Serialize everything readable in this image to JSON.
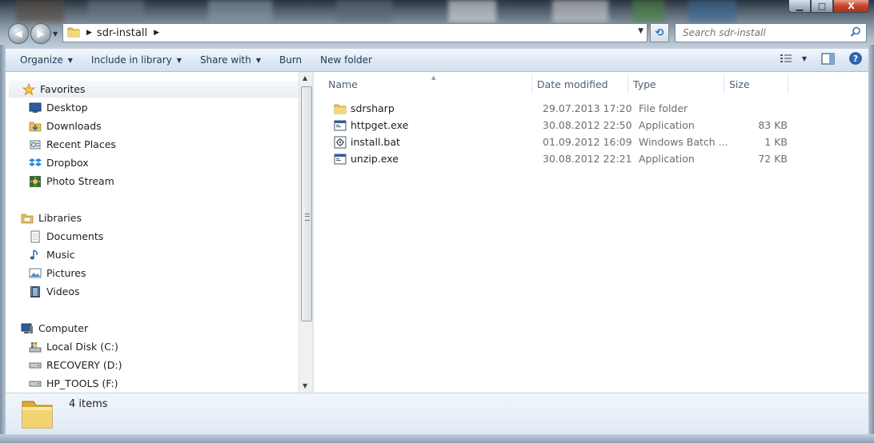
{
  "window": {
    "caption_buttons": {
      "minimize": "▁",
      "maximize": "□",
      "close": "X"
    }
  },
  "address_bar": {
    "path": [
      "sdr-install"
    ],
    "search_placeholder": "Search sdr-install"
  },
  "command_bar": {
    "items": [
      {
        "label": "Organize",
        "dropdown": true
      },
      {
        "label": "Include in library",
        "dropdown": true
      },
      {
        "label": "Share with",
        "dropdown": true
      },
      {
        "label": "Burn",
        "dropdown": false
      },
      {
        "label": "New folder",
        "dropdown": false
      }
    ]
  },
  "navigation": {
    "favorites": {
      "label": "Favorites",
      "items": [
        "Desktop",
        "Downloads",
        "Recent Places",
        "Dropbox",
        "Photo Stream"
      ]
    },
    "libraries": {
      "label": "Libraries",
      "items": [
        "Documents",
        "Music",
        "Pictures",
        "Videos"
      ]
    },
    "computer": {
      "label": "Computer",
      "items": [
        "Local Disk (C:)",
        "RECOVERY (D:)",
        "HP_TOOLS (F:)"
      ]
    }
  },
  "file_list": {
    "columns": [
      "Name",
      "Date modified",
      "Type",
      "Size"
    ],
    "rows": [
      {
        "name": "sdrsharp",
        "date": "29.07.2013 17:20",
        "type": "File folder",
        "size": "",
        "icon": "folder-icon"
      },
      {
        "name": "httpget.exe",
        "date": "30.08.2012 22:50",
        "type": "Application",
        "size": "83 KB",
        "icon": "exe-icon"
      },
      {
        "name": "install.bat",
        "date": "01.09.2012 16:09",
        "type": "Windows Batch ...",
        "size": "1 KB",
        "icon": "batch-icon"
      },
      {
        "name": "unzip.exe",
        "date": "30.08.2012 22:21",
        "type": "Application",
        "size": "72 KB",
        "icon": "exe-icon"
      }
    ]
  },
  "details_pane": {
    "item_count": "4 items"
  },
  "colors": {
    "command_bar_text": "#1e3956",
    "column_header_text": "#4c607a",
    "meta_text": "#6d6d6d"
  }
}
